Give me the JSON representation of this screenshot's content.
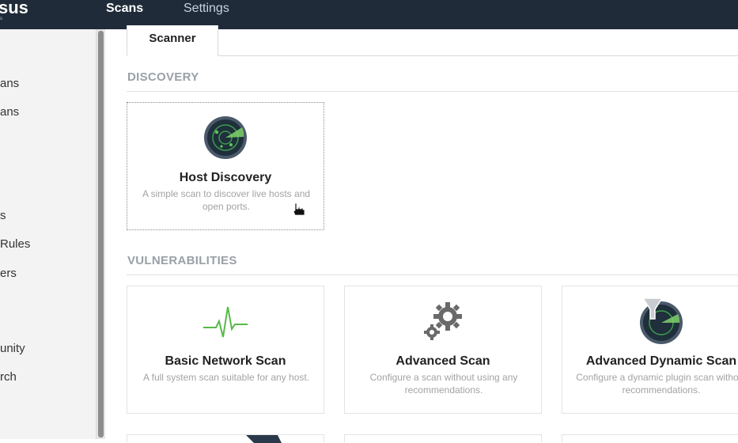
{
  "topbar": {
    "logo_text": "sus",
    "logo_sub": "s",
    "nav_scans": "Scans",
    "nav_settings": "Settings"
  },
  "sidebar": {
    "items": [
      "ans",
      "ans",
      "s",
      " Rules",
      "ers",
      "unity",
      "rch"
    ]
  },
  "tabs": {
    "active": "Scanner"
  },
  "sections": {
    "discovery": "DISCOVERY",
    "vulnerabilities": "VULNERABILITIES"
  },
  "cards": {
    "host_discovery": {
      "title": "Host Discovery",
      "desc": "A simple scan to discover live hosts and open ports."
    },
    "basic_network": {
      "title": "Basic Network Scan",
      "desc": "A full system scan suitable for any host."
    },
    "advanced": {
      "title": "Advanced Scan",
      "desc": "Configure a scan without using any recommendations."
    },
    "advanced_dynamic": {
      "title": "Advanced Dynamic Scan",
      "desc": "Configure a dynamic plugin scan without recommendations."
    }
  },
  "icons": {
    "host_discovery": "radar-icon",
    "basic_network": "heartbeat-icon",
    "advanced": "gears-icon",
    "advanced_dynamic": "radar-filter-icon"
  },
  "colors": {
    "topbar": "#1f2b39",
    "radar_dark": "#2a3a4a",
    "radar_green": "#3e9b4f",
    "pulse_green": "#58b84a"
  }
}
